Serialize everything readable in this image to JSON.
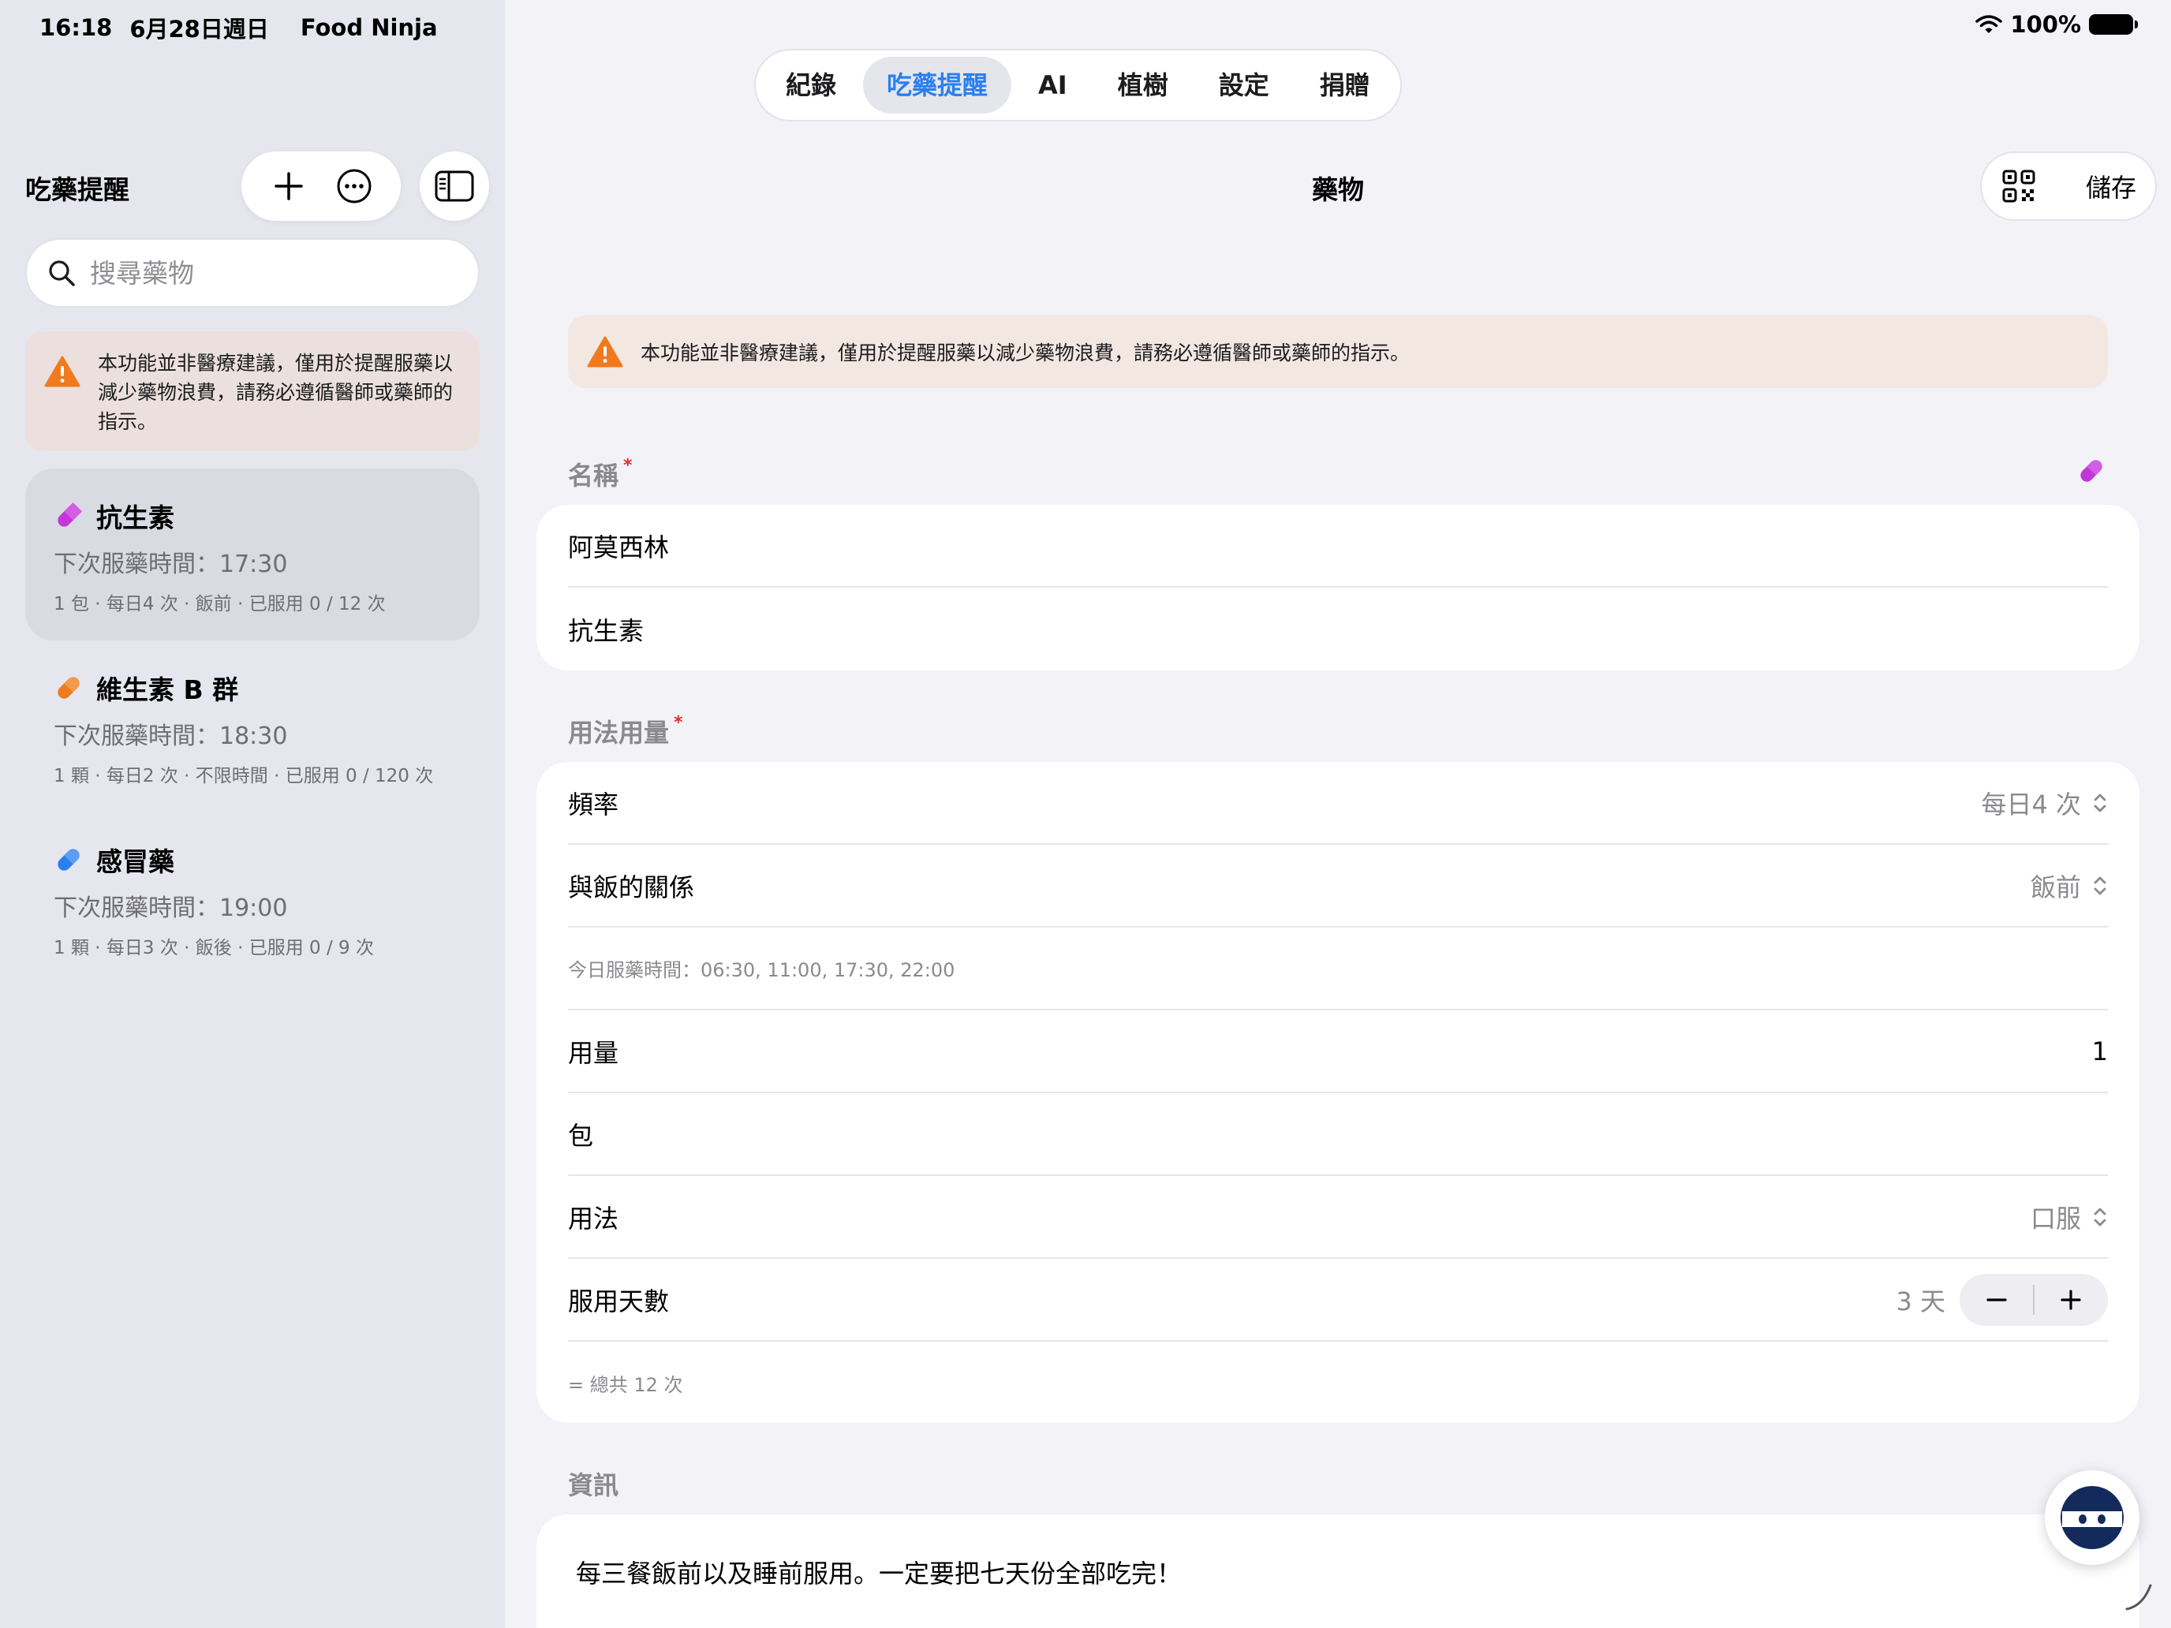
{
  "status_bar": {
    "time": "16:18",
    "date": "6月28日週日",
    "app": "Food Ninja",
    "battery": "100%"
  },
  "sidebar": {
    "title": "吃藥提醒",
    "search_placeholder": "搜尋藥物",
    "warning": "本功能並非醫療建議，僅用於提醒服藥以減少藥物浪費，請務必遵循醫師或藥師的指示。",
    "items": [
      {
        "name": "抗生素",
        "next": "下次服藥時間：17:30",
        "detail": "1 包 · 每日4 次 · 飯前 · 已服用 0 / 12 次",
        "color": "#c238d6"
      },
      {
        "name": "維生素 B 群",
        "next": "下次服藥時間：18:30",
        "detail": "1 顆 · 每日2 次 · 不限時間 · 已服用 0 / 120 次",
        "color": "#f07a1e"
      },
      {
        "name": "感冒藥",
        "next": "下次服藥時間：19:00",
        "detail": "1 顆 · 每日3 次 · 飯後 · 已服用 0 / 9 次",
        "color": "#2a7ff0"
      }
    ]
  },
  "tabs": [
    {
      "label": "紀錄"
    },
    {
      "label": "吃藥提醒"
    },
    {
      "label": "AI"
    },
    {
      "label": "植樹"
    },
    {
      "label": "設定"
    },
    {
      "label": "捐贈"
    }
  ],
  "header": {
    "title": "藥物",
    "save_label": "儲存"
  },
  "main": {
    "warning": "本功能並非醫療建議，僅用於提醒服藥以減少藥物浪費，請務必遵循醫師或藥師的指示。",
    "name_section": {
      "label": "名稱",
      "required_mark": "*",
      "name_value": "阿莫西林",
      "category_value": "抗生素"
    },
    "usage_section": {
      "label": "用法用量",
      "required_mark": "*",
      "frequency_label": "頻率",
      "frequency_value": "每日4 次",
      "meal_label": "與飯的關係",
      "meal_value": "飯前",
      "times_note": "今日服藥時間：06:30, 11:00, 17:30, 22:00",
      "dose_label": "用量",
      "dose_value": "1",
      "unit_value": "包",
      "route_label": "用法",
      "route_value": "口服",
      "days_label": "服用天數",
      "days_value": "3 天",
      "total_note": "= 總共 12 次"
    },
    "info_section": {
      "label": "資訊",
      "note": "每三餐飯前以及睡前服用。一定要把七天份全部吃完！"
    }
  },
  "colors": {
    "accent": "#2a7ff0",
    "warning_icon": "#f07a1e",
    "pill_purple": "#c238d6",
    "required": "#e0302a"
  }
}
